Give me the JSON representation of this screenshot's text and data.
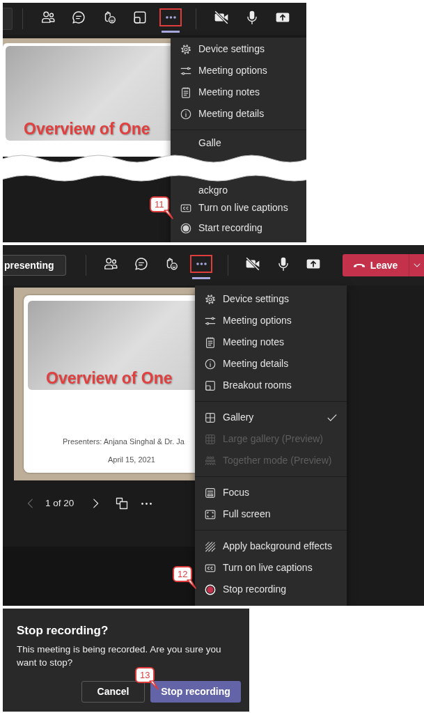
{
  "start_panel": {
    "toolbar_groups": [
      [
        {
          "kind": "field"
        }
      ],
      [
        {
          "kind": "people",
          "selected": false
        },
        {
          "kind": "chat",
          "selected": false
        },
        {
          "kind": "react",
          "selected": false
        },
        {
          "kind": "breakout",
          "selected": false
        },
        {
          "kind": "more",
          "selected": true
        }
      ],
      [
        {
          "kind": "video_off",
          "selected": false
        },
        {
          "kind": "mic",
          "selected": false
        },
        {
          "kind": "share",
          "selected": false
        }
      ]
    ],
    "slide": {
      "title": "Overview of One"
    },
    "menu_top": [
      {
        "kind": "gear",
        "label": "Device settings"
      },
      {
        "kind": "sliders",
        "label": "Meeting options"
      },
      {
        "kind": "notes",
        "label": "Meeting notes"
      },
      {
        "kind": "info",
        "label": "Meeting details"
      },
      {
        "kind": "divider"
      },
      {
        "kind": "partial",
        "label": "Galle"
      }
    ],
    "menu_bottom": [
      {
        "kind": "partial",
        "label": "ackgro"
      },
      {
        "kind": "captions",
        "label": "Turn on live captions"
      },
      {
        "kind": "record_idle",
        "label": "Start recording"
      }
    ],
    "callout": "11"
  },
  "stop_panel": {
    "toolbar_groups": [
      [
        {
          "kind": "text_button",
          "label": "presenting"
        }
      ],
      [
        {
          "kind": "people",
          "selected": false
        },
        {
          "kind": "chat",
          "selected": false
        },
        {
          "kind": "react",
          "selected": false
        },
        {
          "kind": "more",
          "selected": true
        }
      ],
      [
        {
          "kind": "video_off",
          "selected": false
        },
        {
          "kind": "mic",
          "selected": false
        },
        {
          "kind": "share",
          "selected": false
        },
        {
          "kind": "leave",
          "label": "Leave"
        }
      ]
    ],
    "slide": {
      "title": "Overview of One",
      "presenters": "Presenters:  Anjana Singhal & Dr. Ja",
      "date": "April 15, 2021"
    },
    "pager": {
      "prev": {
        "disabled": true
      },
      "label": "1 of 20",
      "next": {
        "disabled": false
      }
    },
    "menu_groups": [
      [
        {
          "kind": "gear",
          "label": "Device settings",
          "checked": false,
          "disabled": false
        },
        {
          "kind": "sliders",
          "label": "Meeting options",
          "checked": false,
          "disabled": false
        },
        {
          "kind": "notes",
          "label": "Meeting notes",
          "checked": false,
          "disabled": false
        },
        {
          "kind": "info",
          "label": "Meeting details",
          "checked": false,
          "disabled": false
        },
        {
          "kind": "breakout",
          "label": "Breakout rooms",
          "checked": false,
          "disabled": false
        }
      ],
      [
        {
          "kind": "gallery",
          "label": "Gallery",
          "checked": true,
          "disabled": false
        },
        {
          "kind": "large_gallery",
          "label": "Large gallery (Preview)",
          "checked": false,
          "disabled": true
        },
        {
          "kind": "together",
          "label": "Together mode (Preview)",
          "checked": false,
          "disabled": true
        }
      ],
      [
        {
          "kind": "focus",
          "label": "Focus",
          "checked": false,
          "disabled": false
        },
        {
          "kind": "fullscreen",
          "label": "Full screen",
          "checked": false,
          "disabled": false
        }
      ],
      [
        {
          "kind": "background",
          "label": "Apply background effects",
          "checked": false,
          "disabled": false
        },
        {
          "kind": "captions",
          "label": "Turn on live captions",
          "checked": false,
          "disabled": false
        },
        {
          "kind": "record_active",
          "label": "Stop recording",
          "checked": false,
          "disabled": false
        }
      ]
    ],
    "callout": "12"
  },
  "confirm_dialog": {
    "title": "Stop recording?",
    "message": "This meeting is being recorded. Are you sure you want to stop?",
    "buttons": [
      {
        "kind": "secondary",
        "label": "Cancel"
      },
      {
        "kind": "primary",
        "label": "Stop recording"
      }
    ],
    "callout": "13"
  }
}
